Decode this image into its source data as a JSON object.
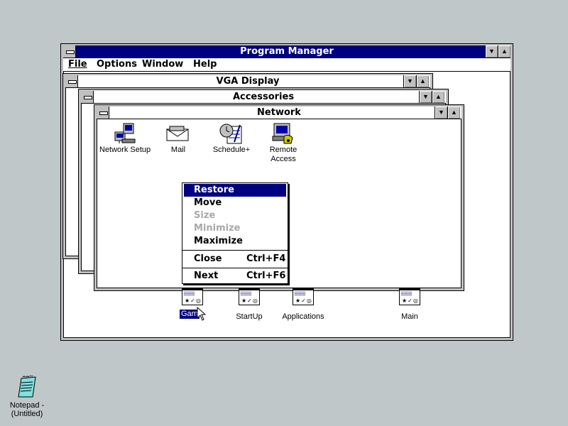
{
  "program_manager": {
    "title": "Program Manager",
    "menu": [
      "File",
      "Options",
      "Window",
      "Help"
    ]
  },
  "windows": {
    "vga": {
      "title": "VGA Display"
    },
    "accessories": {
      "title": "Accessories"
    },
    "network": {
      "title": "Network",
      "icons": [
        {
          "name": "network-setup-icon",
          "label": "Network Setup"
        },
        {
          "name": "mail-icon",
          "label": "Mail"
        },
        {
          "name": "schedule-icon",
          "label": "Schedule+"
        },
        {
          "name": "remote-access-icon",
          "label": "Remote\nAccess"
        }
      ]
    }
  },
  "context_menu": {
    "items": [
      {
        "label": "Restore",
        "state": "selected"
      },
      {
        "label": "Move",
        "state": "enabled"
      },
      {
        "label": "Size",
        "state": "disabled"
      },
      {
        "label": "Minimize",
        "state": "disabled"
      },
      {
        "label": "Maximize",
        "state": "enabled"
      },
      {
        "label": "Close",
        "accel": "Ctrl+F4",
        "state": "enabled"
      },
      {
        "label": "Next",
        "accel": "Ctrl+F6",
        "state": "enabled"
      }
    ]
  },
  "minimized_groups": [
    "Gam",
    "StartUp",
    "Applications",
    "Main"
  ],
  "desktop": {
    "notepad_label_1": "Notepad -",
    "notepad_label_2": "(Untitled)"
  },
  "colors": {
    "desktop": "#c0c7c8",
    "active_title": "#000080",
    "highlight": "#000080"
  }
}
